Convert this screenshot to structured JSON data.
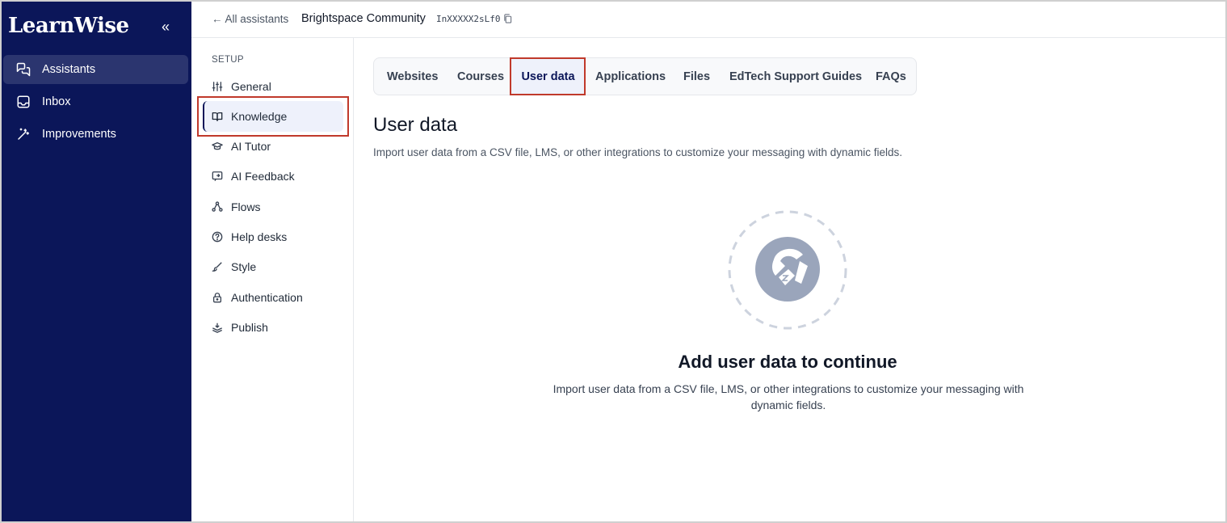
{
  "app": {
    "logo": "LearnWise",
    "collapse_glyph": "«"
  },
  "nav": {
    "items": [
      {
        "label": "Assistants",
        "icon": "assistants-icon",
        "active": true
      },
      {
        "label": "Inbox",
        "icon": "inbox-icon",
        "active": false
      },
      {
        "label": "Improvements",
        "icon": "magic-wand-icon",
        "active": false
      }
    ]
  },
  "topbar": {
    "back_label": "← All assistants",
    "assistant_name": "Brightspace Community",
    "assistant_id": "InXXXXX2sLf0"
  },
  "setup": {
    "heading": "SETUP",
    "items": [
      {
        "label": "General",
        "icon": "sliders-icon"
      },
      {
        "label": "Knowledge",
        "icon": "book-icon",
        "active": true
      },
      {
        "label": "AI Tutor",
        "icon": "graduation-cap-icon"
      },
      {
        "label": "AI Feedback",
        "icon": "feedback-icon"
      },
      {
        "label": "Flows",
        "icon": "flows-icon"
      },
      {
        "label": "Help desks",
        "icon": "help-circle-icon"
      },
      {
        "label": "Style",
        "icon": "brush-icon"
      },
      {
        "label": "Authentication",
        "icon": "lock-icon"
      },
      {
        "label": "Publish",
        "icon": "layers-icon"
      }
    ]
  },
  "tabs": [
    {
      "label": "Websites"
    },
    {
      "label": "Courses"
    },
    {
      "label": "User data",
      "active": true
    },
    {
      "label": "Applications"
    },
    {
      "label": "Files"
    },
    {
      "label": "EdTech Support Guides"
    },
    {
      "label": "FAQs"
    }
  ],
  "main": {
    "title": "User data",
    "subtitle": "Import user data from a CSV file, LMS, or other integrations to customize your messaging with dynamic fields.",
    "empty_title": "Add user data to continue",
    "empty_desc": "Import user data from a CSV file, LMS, or other integrations to customize your messaging with dynamic fields."
  },
  "colors": {
    "nav_bg": "#0b1659",
    "accent": "#0b1659",
    "highlight": "#c0392b",
    "illustration": "#9aa5bb"
  }
}
